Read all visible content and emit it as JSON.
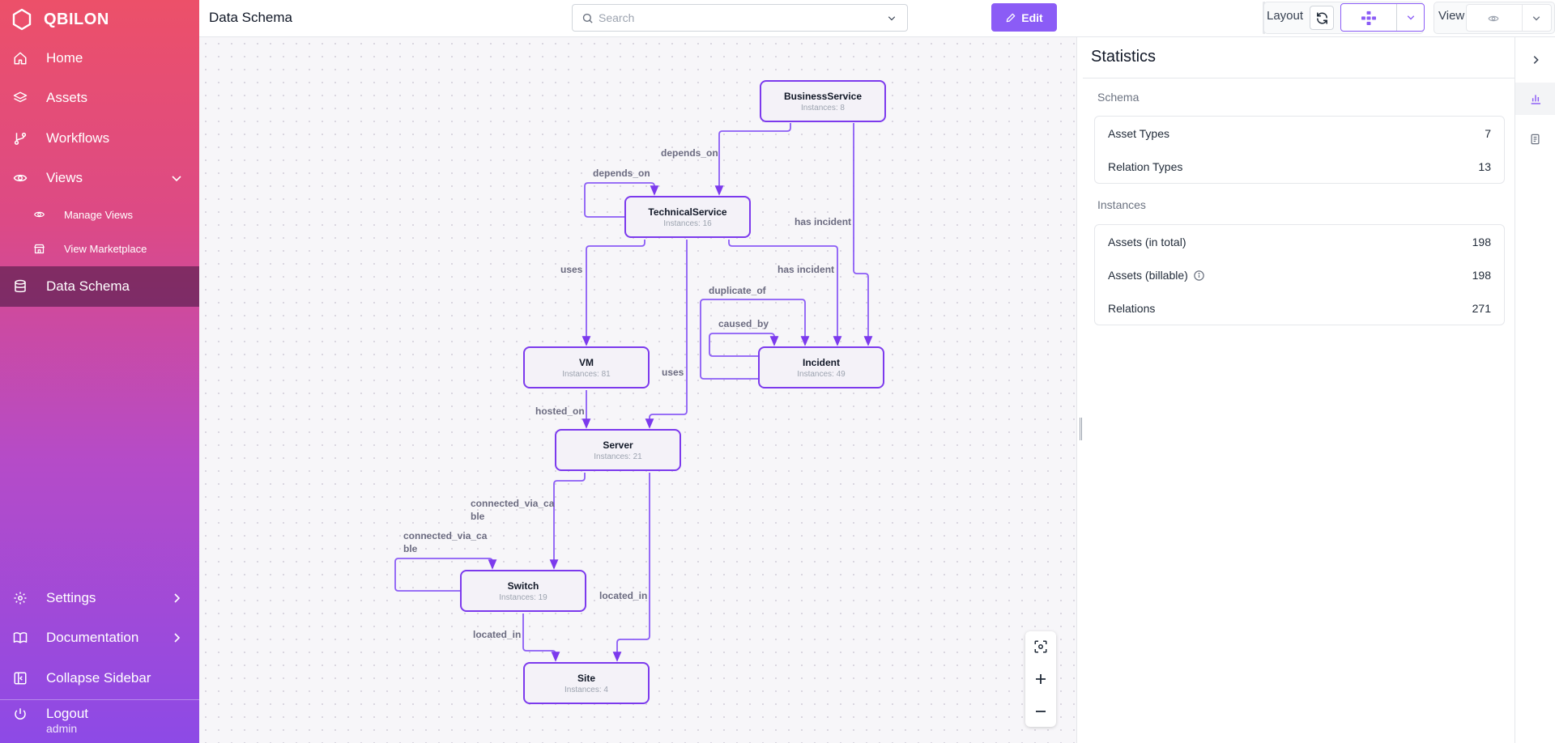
{
  "brand": {
    "name": "QBILON"
  },
  "sidebar": {
    "items": [
      {
        "label": "Home",
        "icon": "home-icon"
      },
      {
        "label": "Assets",
        "icon": "layers-icon"
      },
      {
        "label": "Workflows",
        "icon": "git-branch-icon"
      },
      {
        "label": "Views",
        "icon": "eye-icon"
      },
      {
        "label": "Manage Views",
        "icon": "eye-icon"
      },
      {
        "label": "View Marketplace",
        "icon": "store-icon"
      },
      {
        "label": "Data Schema",
        "icon": "database-icon"
      },
      {
        "label": "Settings",
        "icon": "gear-icon"
      },
      {
        "label": "Documentation",
        "icon": "book-icon"
      },
      {
        "label": "Collapse Sidebar",
        "icon": "sidebar-icon"
      },
      {
        "label": "Logout",
        "icon": "power-icon"
      }
    ],
    "user": "admin",
    "active_color": "#4d1f4a"
  },
  "header": {
    "title": "Data Schema",
    "search_placeholder": "Search",
    "edit_label": "Edit",
    "layout_label": "Layout",
    "view_label": "View",
    "accent": "#8b5cf6"
  },
  "graph": {
    "instances_prefix": "Instances: ",
    "nodes": [
      {
        "name": "BusinessService",
        "instances": "8"
      },
      {
        "name": "TechnicalService",
        "instances": "16"
      },
      {
        "name": "VM",
        "instances": "81"
      },
      {
        "name": "Incident",
        "instances": "49"
      },
      {
        "name": "Server",
        "instances": "21"
      },
      {
        "name": "Switch",
        "instances": "19"
      },
      {
        "name": "Site",
        "instances": "4"
      }
    ],
    "edge_labels": [
      "depends_on",
      "depends_on",
      "has incident",
      "has incident",
      "uses",
      "uses",
      "duplicate_of",
      "caused_by",
      "hosted_on",
      "connected_via_ca\nble",
      "connected_via_ca\nble",
      "located_in",
      "located_in"
    ]
  },
  "statistics": {
    "title": "Statistics",
    "schema_title": "Schema",
    "schema": [
      {
        "label": "Asset Types",
        "value": "7"
      },
      {
        "label": "Relation Types",
        "value": "13"
      }
    ],
    "instances_title": "Instances",
    "instances": [
      {
        "label": "Assets (in total)",
        "value": "198"
      },
      {
        "label": "Assets (billable)",
        "value": "198"
      },
      {
        "label": "Relations",
        "value": "271"
      }
    ]
  }
}
